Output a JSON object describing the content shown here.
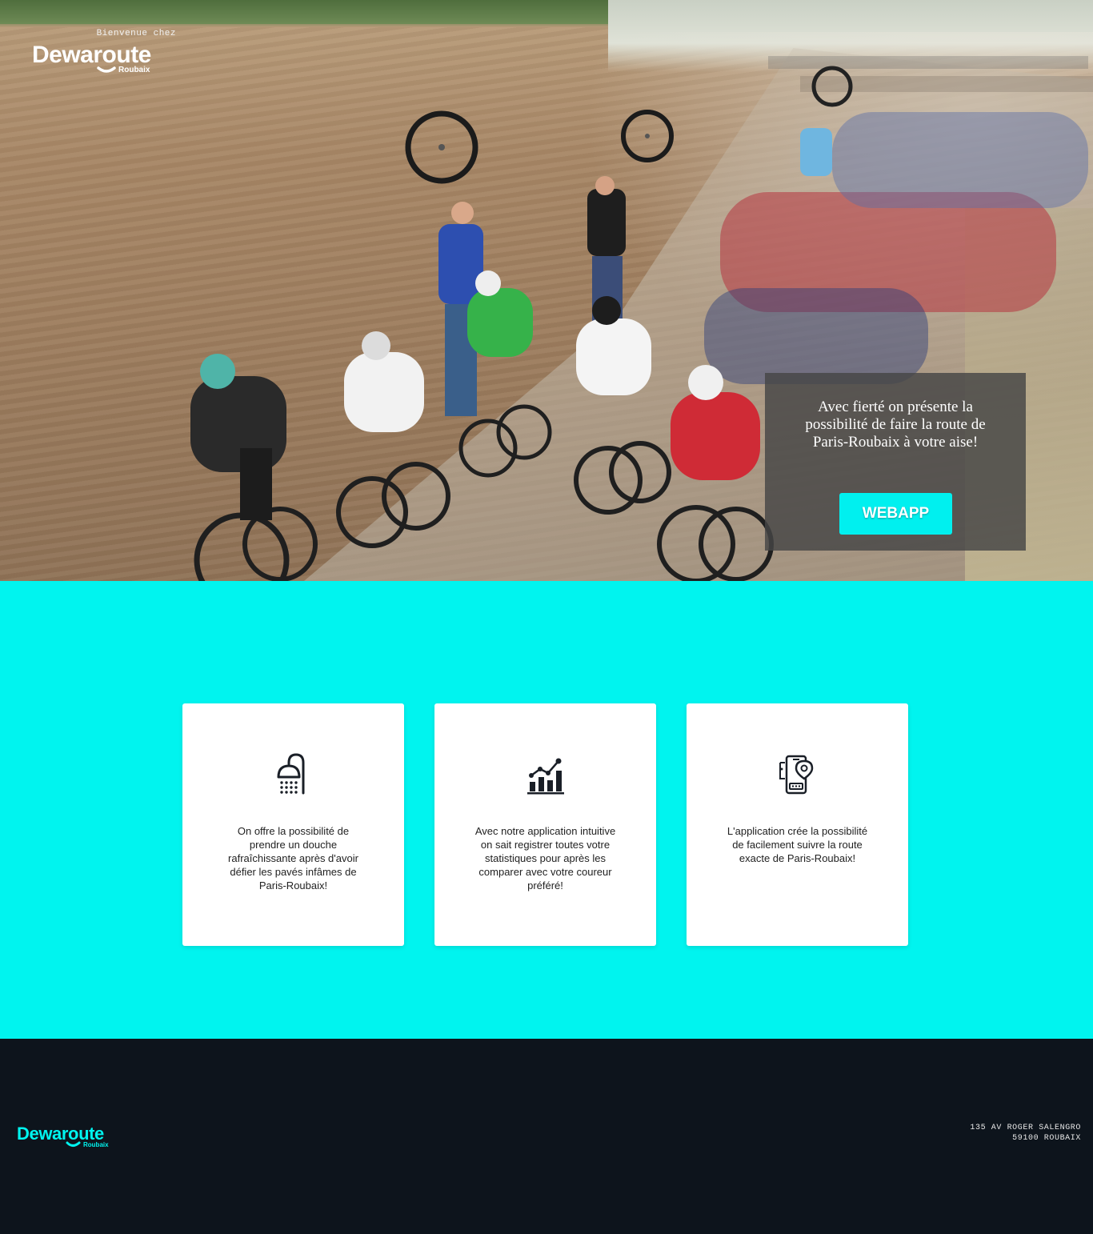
{
  "hero": {
    "welcome": "Bienvenue chez",
    "logo_word": "Dewaroute",
    "logo_sub": "Roubaix",
    "promo_text": "Avec fierté on présente la possibilité de  faire la route de Paris-Roubaix à votre aise!",
    "cta_label": "WEBAPP"
  },
  "features": {
    "cards": [
      {
        "icon": "shower-icon",
        "text": "On offre la possibilité de prendre un douche rafraîchissante après d'avoir défier les pavés infâmes de Paris-Roubaix!"
      },
      {
        "icon": "chart-growth-icon",
        "text": "Avec notre application intuitive on sait registrer toutes votre statistiques pour après les comparer avec votre coureur préféré!"
      },
      {
        "icon": "phone-map-icon",
        "text": "L'application crée la possibilité de facilement suivre la route exacte de Paris-Roubaix!"
      }
    ]
  },
  "footer": {
    "logo_word": "Dewaroute",
    "logo_sub": "Roubaix",
    "address_line1": "135 AV ROGER SALENGRO",
    "address_line2": "59100 ROUBAIX"
  },
  "colors": {
    "accent": "#00f4ef",
    "footer_bg": "#0d141c",
    "promo_bg": "#464646"
  }
}
